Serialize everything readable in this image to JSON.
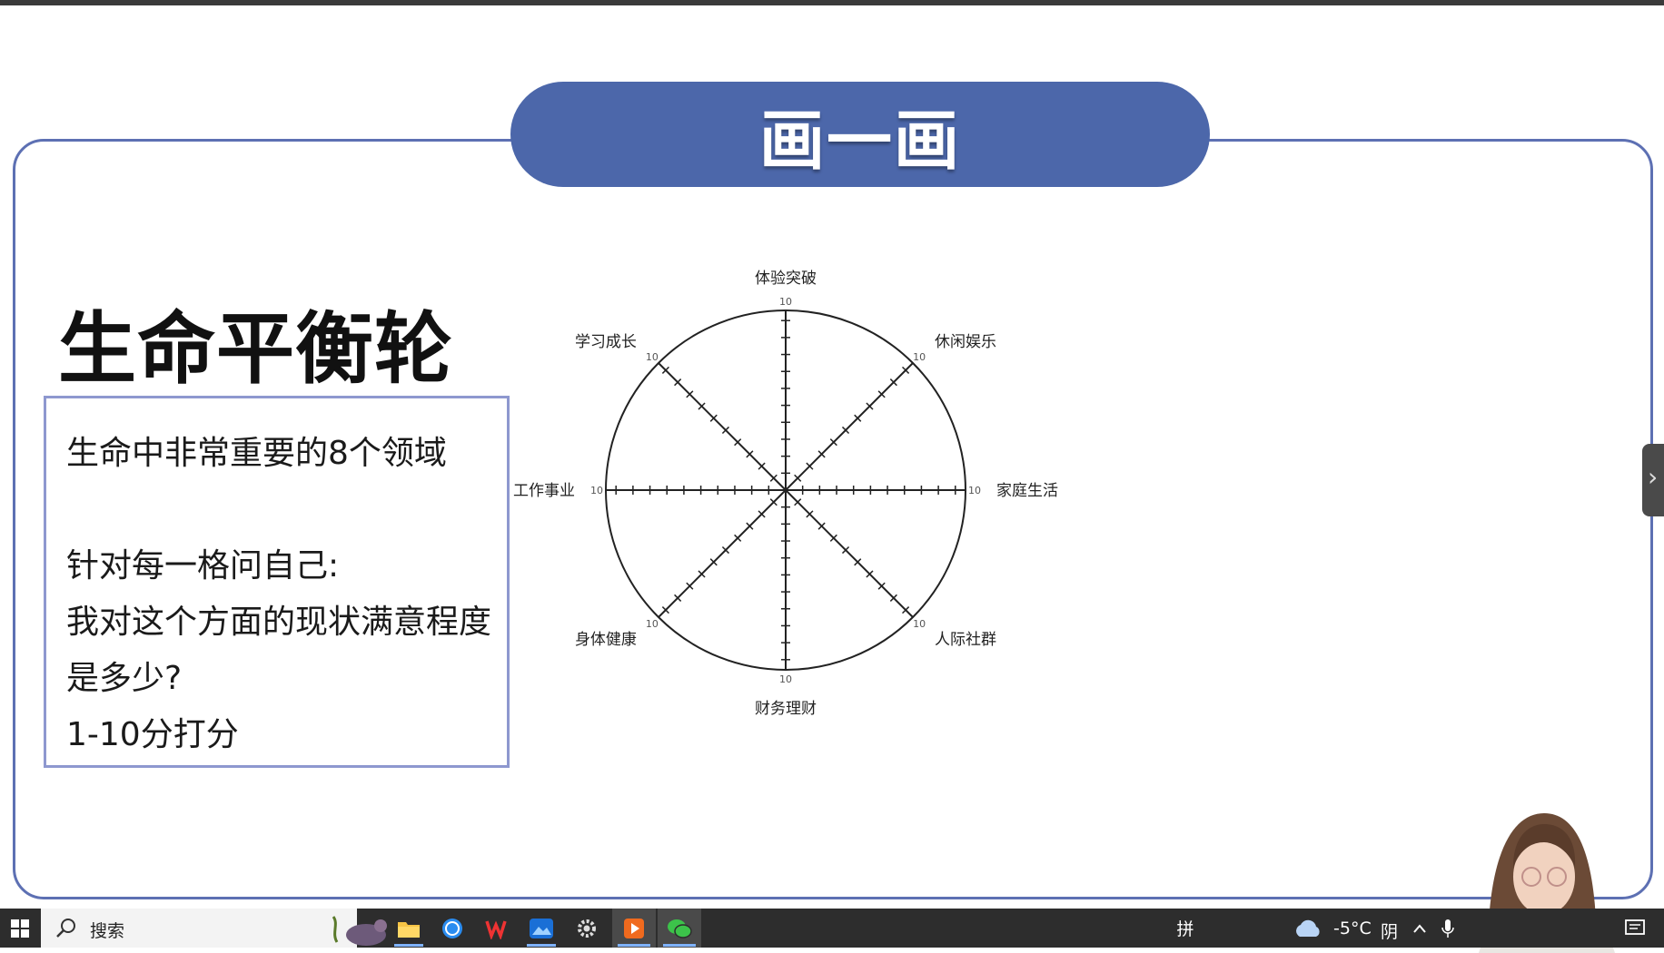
{
  "slide": {
    "banner_title": "画一画",
    "main_title": "生命平衡轮",
    "text_box": {
      "line1": "生命中非常重要的8个领域",
      "line2": "针对每一格问自己:",
      "line3": "我对这个方面的现状满意程度",
      "line4": "是多少?",
      "line5": "1-10分打分"
    },
    "wheel": {
      "scale_max_label": "10",
      "areas": {
        "top": "体验突破",
        "top_right": "休闲娱乐",
        "right": "家庭生活",
        "bottom_right": "人际社群",
        "bottom": "财务理财",
        "bottom_left": "身体健康",
        "left": "工作事业",
        "top_left": "学习成长"
      },
      "ticks_per_spoke": 10
    }
  },
  "ui": {
    "side_handle_glyph": "›"
  },
  "taskbar": {
    "search_placeholder": "搜索",
    "ime_indicator": "拼",
    "weather_temp": "-5°C",
    "weather_desc": "阴",
    "icons": [
      "windows-start-icon",
      "search-icon",
      "file-explorer-icon",
      "kugou-icon",
      "wps-icon",
      "photos-icon",
      "settings-icon",
      "media-player-icon",
      "wechat-icon",
      "weather-cloud-icon",
      "chevron-up-icon",
      "microphone-icon",
      "notification-icon"
    ]
  },
  "colors": {
    "banner": "#4c67aa",
    "frame": "#5d70b3",
    "text_box_border": "#8e98cf",
    "taskbar": "#2d2d2d"
  }
}
